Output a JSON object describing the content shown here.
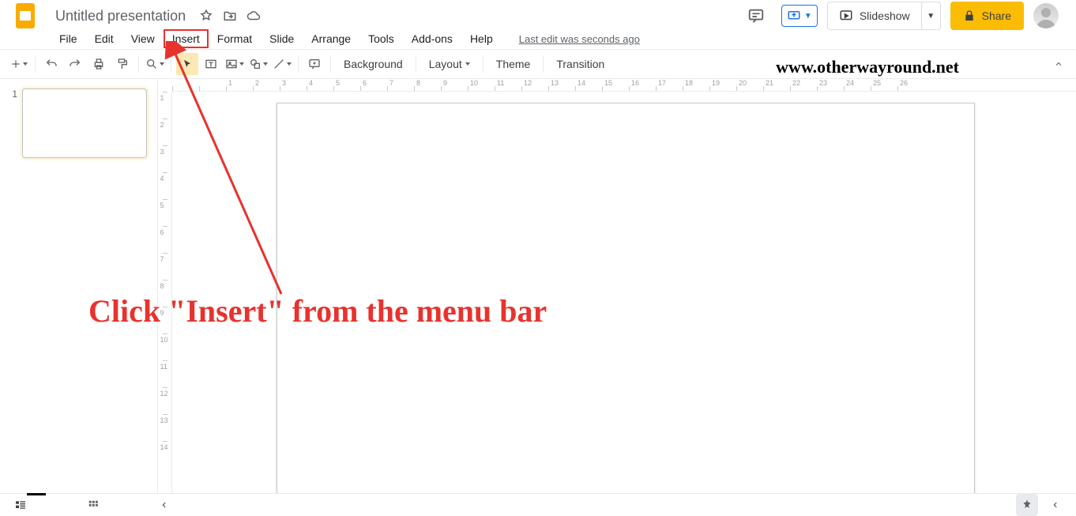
{
  "doc": {
    "title": "Untitled presentation"
  },
  "menus": {
    "file": "File",
    "edit": "Edit",
    "view": "View",
    "insert": "Insert",
    "format": "Format",
    "slide": "Slide",
    "arrange": "Arrange",
    "tools": "Tools",
    "addons": "Add-ons",
    "help": "Help",
    "last_edit": "Last edit was seconds ago"
  },
  "toolbar": {
    "background": "Background",
    "layout": "Layout",
    "theme": "Theme",
    "transition": "Transition"
  },
  "header": {
    "slideshow": "Slideshow",
    "share": "Share"
  },
  "sidebar": {
    "thumb1_num": "1"
  },
  "annotation": {
    "text": "Click \"Insert\" from the menu bar",
    "watermark": "www.otherwayround.net"
  }
}
